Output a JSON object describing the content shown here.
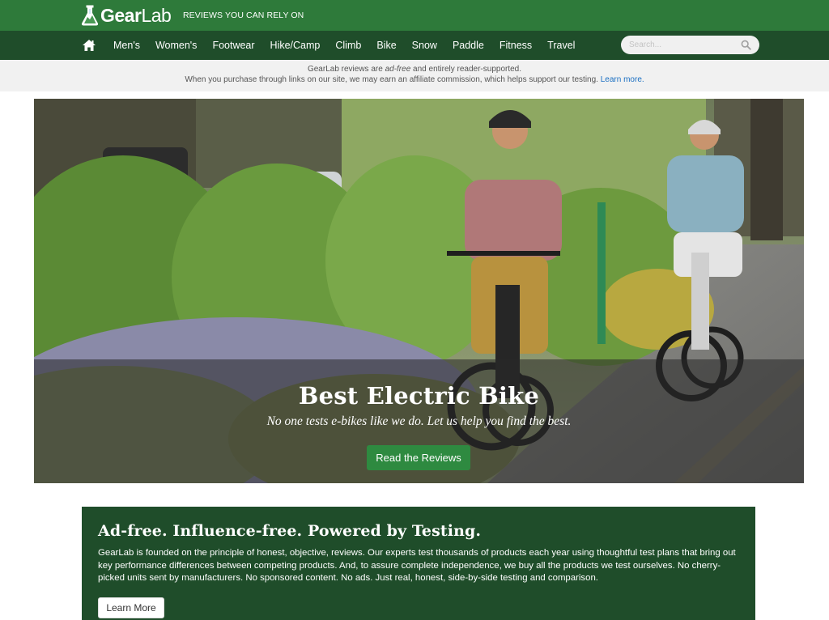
{
  "brand": {
    "name_bold": "Gear",
    "name_light": "Lab",
    "tagline": "REVIEWS YOU CAN RELY ON",
    "primary_color": "#2e7a3a",
    "nav_color": "#1f4d2a"
  },
  "nav": {
    "home_icon": "home-icon",
    "items": [
      {
        "label": "Men's"
      },
      {
        "label": "Women's"
      },
      {
        "label": "Footwear"
      },
      {
        "label": "Hike/Camp"
      },
      {
        "label": "Climb"
      },
      {
        "label": "Bike"
      },
      {
        "label": "Snow"
      },
      {
        "label": "Paddle"
      },
      {
        "label": "Fitness"
      },
      {
        "label": "Travel"
      }
    ],
    "search": {
      "placeholder": "Search...",
      "value": "",
      "icon": "search-icon"
    }
  },
  "disclosure": {
    "line1_pre": "GearLab reviews are ",
    "line1_em": "ad-free",
    "line1_post": " and entirely reader-supported.",
    "line2": "When you purchase through links on our site, we may earn an affiliate commission, which helps support our testing. ",
    "link": "Learn more."
  },
  "hero": {
    "title": "Best Electric Bike",
    "subtitle": "No one tests e-bikes like we do. Let us help you find the best.",
    "button": "Read the Reviews",
    "image_alt": "Two cyclists riding electric bikes on a paved path lined with green plants and lavender"
  },
  "adfree": {
    "title": "Ad-free. Influence-free. Powered by Testing.",
    "body": "GearLab is founded on the principle of honest, objective, reviews. Our experts test thousands of products each year using thoughtful test plans that bring out key performance differences between competing products. And, to assure complete independence, we buy all the products we test ourselves. No cherry-picked units sent by manufacturers. No sponsored content. No ads. Just real, honest, side-by-side testing and comparison.",
    "button": "Learn More"
  }
}
